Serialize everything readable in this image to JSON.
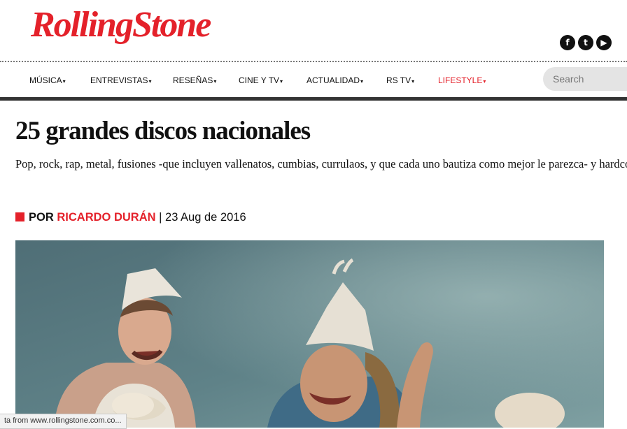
{
  "brand": {
    "logo_text": "RollingStone",
    "accent": "#e4212a"
  },
  "social": [
    {
      "icon": "facebook-icon",
      "glyph": "f"
    },
    {
      "icon": "twitter-icon",
      "glyph": "t"
    },
    {
      "icon": "youtube-icon",
      "glyph": "▶"
    }
  ],
  "nav": {
    "items": [
      {
        "label": "MÚSICA"
      },
      {
        "label": "ENTREVISTAS"
      },
      {
        "label": "RESEÑAS"
      },
      {
        "label": "CINE Y TV"
      },
      {
        "label": "ACTUALIDAD"
      },
      {
        "label": "RS TV"
      },
      {
        "label": "LIFESTYLE"
      }
    ],
    "caret": "▾",
    "search_placeholder": "Search"
  },
  "article": {
    "title": "25 grandes discos nacionales",
    "subtitle": "Pop, rock, rap, metal, fusiones -que incluyen vallenatos, cumbias, currulaos, y que cada uno bautiza como mejor le parezca- y hardcore.",
    "byline_prefix": "POR",
    "author": "RICARDO DURÁN",
    "separator": "|",
    "date": "23 Aug de 2016"
  },
  "status_bar": {
    "text": "ta from www.rollingstone.com.co..."
  }
}
